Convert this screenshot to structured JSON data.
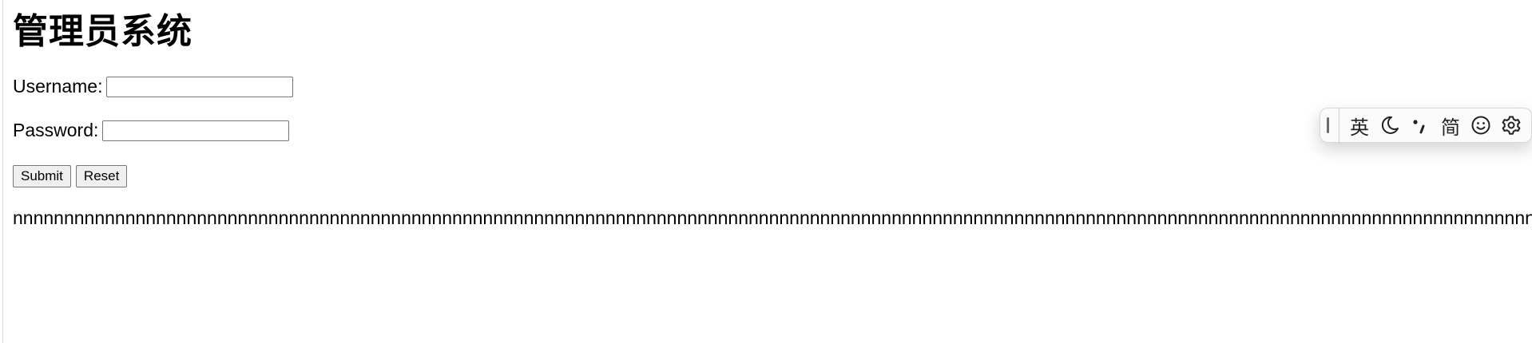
{
  "page": {
    "title": "管理员系统"
  },
  "form": {
    "username_label": "Username:",
    "username_value": "",
    "password_label": "Password:",
    "password_value": "",
    "submit_label": "Submit",
    "reset_label": "Reset"
  },
  "output_text": "nnnnnnnnnnnnnnnnnnnnnnnnnnnnnnnnnnnnnnnnnnnnnnnnnnnnnnnnnnnnnnnnnnnnnnnnnnnnnnnnnnnnnnnnnnnnnnnnnnnnnnnnnnnnnnnnnnnnnnnnnnnnnnnnnnnnnnnnnnnnnnnnnnnnnnnnnnnnnnnnnnnnnnnnnnnnnnnnnnnnn",
  "ime_toolbar": {
    "language_label": "英",
    "script_label": "简",
    "icons": [
      "drag-grip-icon",
      "moon-icon",
      "punctuation-icon",
      "emoji-icon",
      "gear-icon"
    ]
  }
}
